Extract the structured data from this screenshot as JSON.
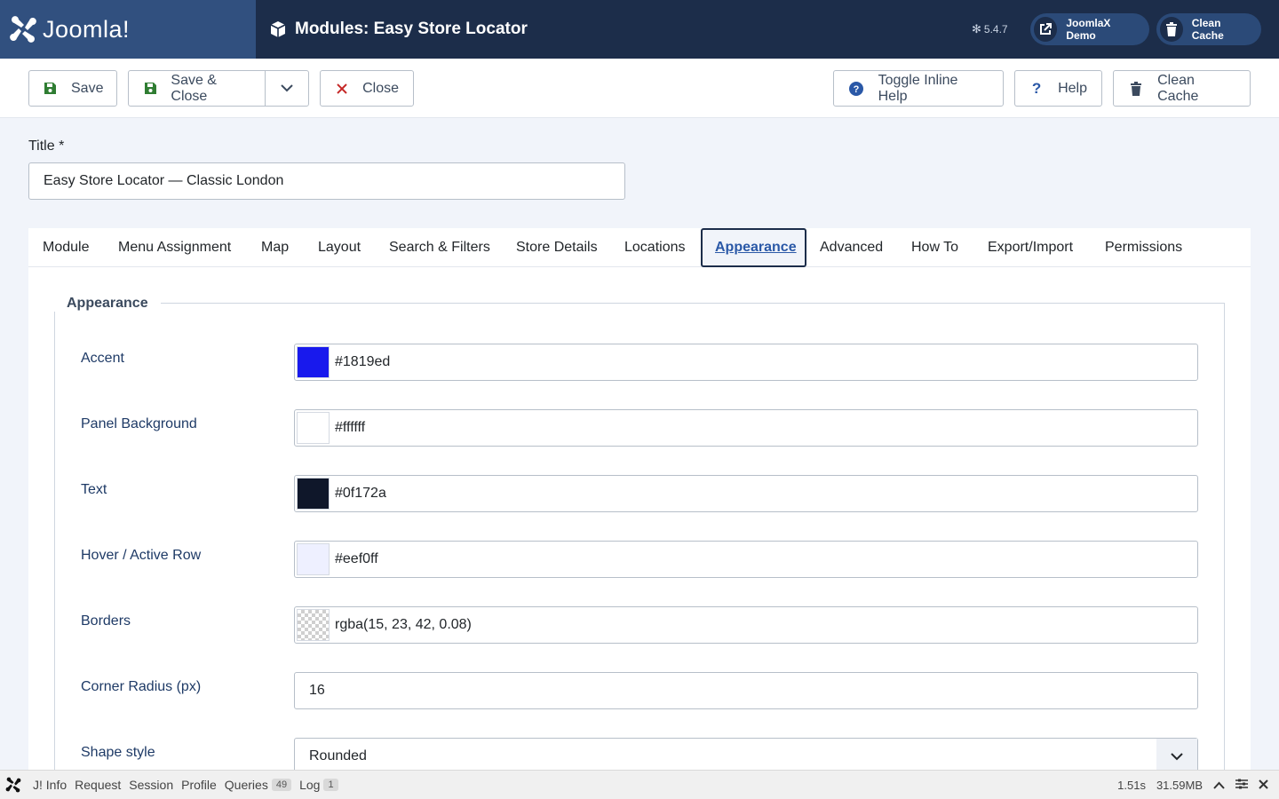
{
  "header": {
    "brand": "Joomla!",
    "title": "Modules: Easy Store Locator",
    "version": "5.4.7",
    "demo_label": "JoomlaX Demo",
    "cache_label": "Clean Cache"
  },
  "toolbar": {
    "save": "Save",
    "save_close": "Save & Close",
    "close": "Close",
    "toggle_help": "Toggle Inline Help",
    "help": "Help",
    "clean_cache": "Clean Cache"
  },
  "form": {
    "title_label": "Title *",
    "title_value": "Easy Store Locator — Classic London"
  },
  "tabs": [
    {
      "label": "Module"
    },
    {
      "label": "Menu Assignment"
    },
    {
      "label": "Map"
    },
    {
      "label": "Layout"
    },
    {
      "label": "Search & Filters"
    },
    {
      "label": "Store Details"
    },
    {
      "label": "Locations"
    },
    {
      "label": "Appearance",
      "active": true
    },
    {
      "label": "Advanced"
    },
    {
      "label": "How To"
    },
    {
      "label": "Export/Import"
    },
    {
      "label": "Permissions"
    }
  ],
  "appearance": {
    "legend": "Appearance",
    "fields": [
      {
        "label": "Accent",
        "value": "#1819ed",
        "swatch": "#1819ed"
      },
      {
        "label": "Panel Background",
        "value": "#ffffff",
        "swatch": "#ffffff"
      },
      {
        "label": "Text",
        "value": "#0f172a",
        "swatch": "#0f172a"
      },
      {
        "label": "Hover / Active Row",
        "value": "#eef0ff",
        "swatch": "#eef0ff"
      },
      {
        "label": "Borders",
        "value": "rgba(15, 23, 42, 0.08)",
        "swatch": "transparent"
      },
      {
        "label": "Corner Radius (px)",
        "value": "16"
      },
      {
        "label": "Shape style",
        "value": "Rounded"
      }
    ]
  },
  "debug": {
    "info": "J! Info",
    "request": "Request",
    "session": "Session",
    "profile": "Profile",
    "queries": "Queries",
    "queries_count": "49",
    "log": "Log",
    "log_count": "1",
    "time": "1.51s",
    "memory": "31.59MB"
  },
  "colors": {
    "header_bg": "#1c2d4a",
    "brand_bg": "#31507f",
    "link": "#2a58a7",
    "save_icon": "#2f7d32",
    "close_icon": "#c52827"
  }
}
